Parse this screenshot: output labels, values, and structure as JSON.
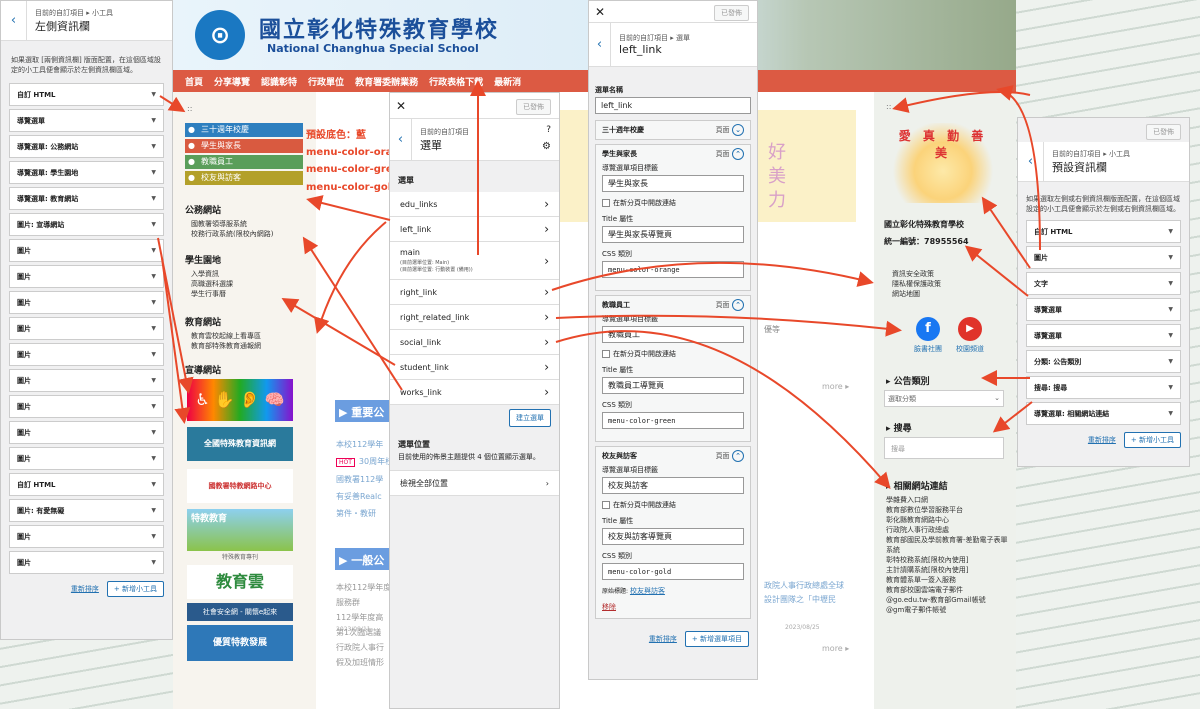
{
  "left_customizer": {
    "crumb": "目前的自訂項目 ▸ 小工具",
    "title": "左側資訊欄",
    "desc": "如果選取 [兩側資訊欄] 版面配置，在這個區域設定的小工具便會顯示於左側資訊欄區域。",
    "widgets": [
      "自訂 HTML",
      "導覽選單",
      "導覽選單: 公務網站",
      "導覽選單: 學生園地",
      "導覽選單: 教育網站",
      "圖片: 宣導網站",
      "圖片",
      "圖片",
      "圖片",
      "圖片",
      "圖片",
      "圖片",
      "圖片",
      "圖片",
      "圖片",
      "自訂 HTML",
      "圖片: 有愛無礙",
      "圖片",
      "圖片"
    ],
    "reorder": "重新排序",
    "add": "新增小工具"
  },
  "header": {
    "school_cn": "國立彰化特殊教育學校",
    "school_en": "National Changhua Special School",
    "nav": [
      "首頁",
      "分享導覽",
      "認識彰特",
      "行政單位",
      "教育署委辦業務",
      "行政表格下載",
      "最新消"
    ]
  },
  "left_sidebar": {
    "dots": "::",
    "menu_buttons": [
      {
        "label": "三十週年校慶",
        "color": "#2e7fbf"
      },
      {
        "label": "學生與家長",
        "color": "#d95a40"
      },
      {
        "label": "教職員工",
        "color": "#5a9e5a"
      },
      {
        "label": "校友與訪客",
        "color": "#b3a02a"
      }
    ],
    "annotations": [
      "預設底色：藍",
      "menu-color-orange",
      "menu-color-green",
      "menu-color-gold"
    ],
    "sections": [
      {
        "title": "公務網站",
        "items": [
          "國教署領導服系統",
          "校務行政系統(限校內網路)"
        ]
      },
      {
        "title": "學生園地",
        "items": [
          "入學資訊",
          "高職選科選課",
          "學生行事曆"
        ]
      },
      {
        "title": "教育網站",
        "items": [
          "教育雲校起線上看專區",
          "教育部特殊教育通報網"
        ]
      },
      {
        "title": "宣導網站",
        "items": []
      }
    ],
    "banners": [
      "全國特殊教育資訊網",
      "國教署特教網路中心",
      "特教教育",
      "特殊教育專刊",
      "教育雲",
      "社會安全網 - 關懷e起來",
      "優質特教發展"
    ]
  },
  "menus_panel": {
    "crumb": "目前的自訂項目",
    "title": "選單",
    "published": "已發佈",
    "section": "選單",
    "menus": [
      {
        "name": "edu_links"
      },
      {
        "name": "left_link"
      },
      {
        "name": "main",
        "note": "(目前選單位置: Main)\n(目前選單位置: 行動裝置 (備用))"
      },
      {
        "name": "right_link"
      },
      {
        "name": "right_related_link"
      },
      {
        "name": "social_link"
      },
      {
        "name": "student_link"
      },
      {
        "name": "works_link"
      }
    ],
    "create": "建立選單",
    "loc_title": "選單位置",
    "loc_desc": "目前使用的佈景主題提供 4 個位置顯示選單。",
    "view_all": "檢視全部位置"
  },
  "menu_edit": {
    "crumb": "目前的自訂項目 ▸ 選單",
    "title": "left_link",
    "published": "已發佈",
    "name_label": "選單名稱",
    "name_value": "left_link",
    "type_label": "頁面",
    "items": [
      {
        "title": "三十週年校慶",
        "collapsed": true
      },
      {
        "title": "學生與家長",
        "nav_label": "學生與家長",
        "title_attr": "學生與家長導覽頁",
        "css": "menu-color-orange"
      },
      {
        "title": "教職員工",
        "nav_label": "教職員工",
        "title_attr": "教職員工導覽頁",
        "css": "menu-color-green"
      },
      {
        "title": "校友與訪客",
        "nav_label": "校友與訪客",
        "title_attr": "校友與訪客導覽頁",
        "css": "menu-color-gold",
        "original": "校友與訪客",
        "remove": "移除"
      }
    ],
    "labels": {
      "nav": "導覽選單項目標籤",
      "newtab": "在新分頁中開啟連結",
      "title": "Title 屬性",
      "css": "CSS 類別",
      "original": "原始標題:"
    },
    "reorder": "重新排序",
    "add": "新增選單項目"
  },
  "right_sidebar": {
    "dots": "::",
    "logo_text": "愛 真 勤 善 美",
    "school": "國立彰化特殊教育學校",
    "tax_id": "統一編號：78955564",
    "links1": [
      "資訊安全政策",
      "隱私權保護政策",
      "網站地圖"
    ],
    "social": [
      {
        "label": "臉書社團",
        "color": "#1877f2",
        "glyph": "f"
      },
      {
        "label": "校園頻道",
        "color": "#e0332a",
        "glyph": "▶"
      }
    ],
    "notice_title": "公告類別",
    "notice_select": "選取分類",
    "search_title": "搜尋",
    "search_placeholder": "搜尋",
    "related_title": "相關網站連結",
    "related": [
      "學雜費入口網",
      "教育部數位學習服務平台",
      "彰化縣教育網路中心",
      "行政院人事行政總處",
      "教育部國民及學前教育署-差勤電子表單系統",
      "彰特校務系統[限校內使用]",
      "主計請購系統[限校內使用]",
      "教育體系單一簽入服務",
      "教育部校園雲端電子郵件",
      "@go.edu.tw-教育部Gmail帳號",
      "@gm電子郵件帳號"
    ]
  },
  "right_customizer": {
    "crumb": "目前的自訂項目 ▸ 小工具",
    "title": "預設資訊欄",
    "published": "已發佈",
    "desc": "如果選取左側或右側資訊欄版面配置，在這個區域設定的小工具便會顯示於左側或右側資訊欄區域。",
    "widgets": [
      "自訂 HTML",
      "圖片",
      "文字",
      "導覽選單",
      "導覽選單",
      "分類: 公告類別",
      "搜尋: 搜尋",
      "導覽選單: 相關網站連結"
    ],
    "reorder": "重新排序",
    "add": "新增小工具"
  },
  "news": {
    "heading1": "▶ 重要公",
    "heading2": "▶ 一般公",
    "more": "more ▸",
    "hot": "HOT",
    "items1": [
      "本校112學年",
      "30周年校慶",
      "國教署112學",
      "有妥善Realc",
      "第件・教研"
    ],
    "items2": [
      "本校112學年度",
      "服務群",
      "112學年度高",
      "第1次臨選議",
      "行政院人事行",
      "假及加班情形"
    ],
    "dates": [
      "2023/09/11",
      "2023/09/08",
      "2023/08/25"
    ],
    "right_texts": [
      "優等",
      "政院人事行政總處全球",
      "設計團隊之「中壢民"
    ],
    "hero": [
      "好",
      "美",
      "力"
    ]
  }
}
